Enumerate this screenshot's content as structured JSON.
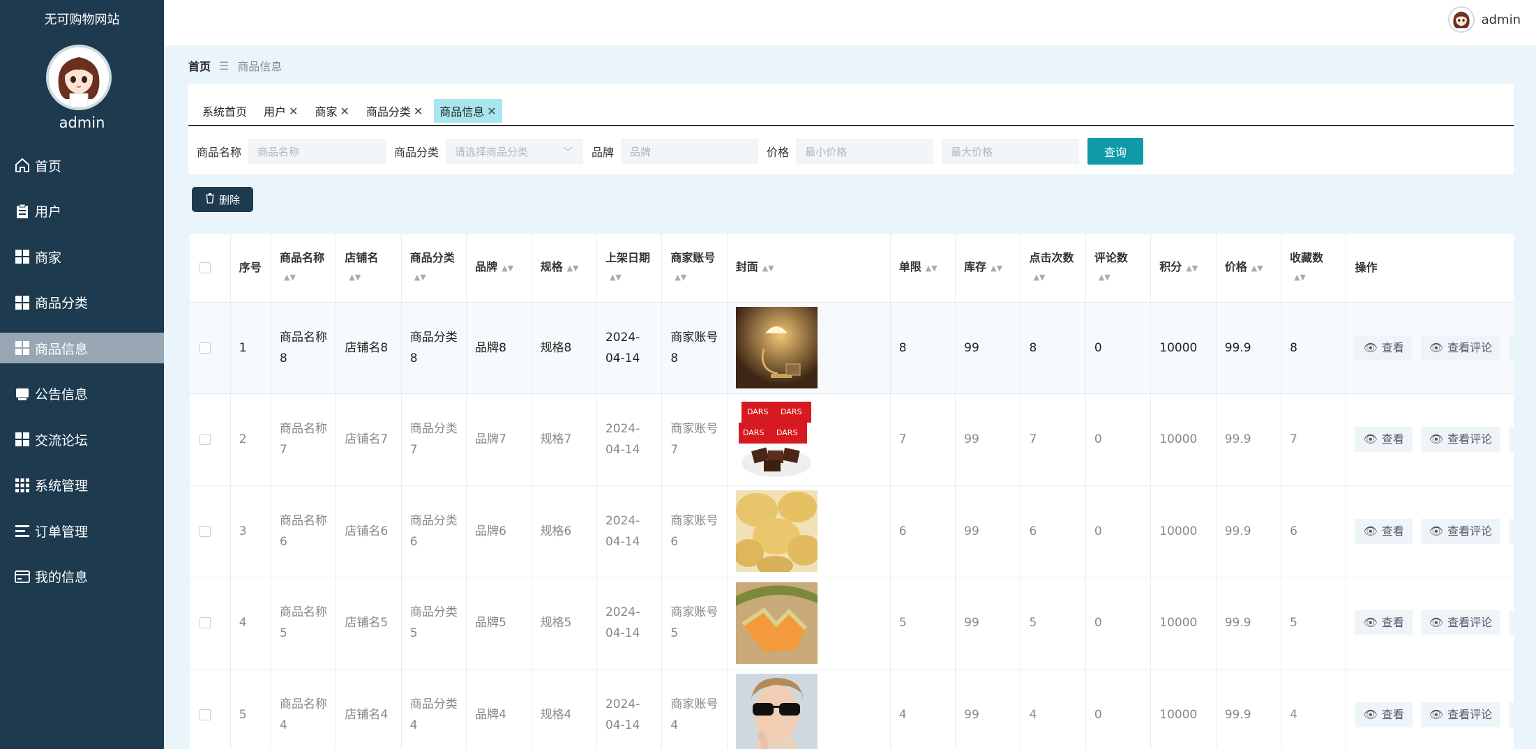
{
  "sidebar": {
    "site_title": "无可购物网站",
    "user_name": "admin",
    "items": [
      {
        "label": "首页",
        "icon": "home-icon"
      },
      {
        "label": "用户",
        "icon": "clipboard-icon"
      },
      {
        "label": "商家",
        "icon": "grid-icon"
      },
      {
        "label": "商品分类",
        "icon": "grid-icon"
      },
      {
        "label": "商品信息",
        "icon": "grid-icon",
        "active": true
      },
      {
        "label": "公告信息",
        "icon": "notice-icon"
      },
      {
        "label": "交流论坛",
        "icon": "grid-icon"
      },
      {
        "label": "系统管理",
        "icon": "apps-icon"
      },
      {
        "label": "订单管理",
        "icon": "list-icon"
      },
      {
        "label": "我的信息",
        "icon": "card-icon"
      }
    ]
  },
  "header": {
    "user_name": "admin"
  },
  "breadcrumb": {
    "home": "首页",
    "current": "商品信息"
  },
  "tabs": [
    {
      "label": "系统首页",
      "closable": false
    },
    {
      "label": "用户",
      "closable": true
    },
    {
      "label": "商家",
      "closable": true
    },
    {
      "label": "商品分类",
      "closable": true
    },
    {
      "label": "商品信息",
      "closable": true,
      "active": true
    }
  ],
  "search": {
    "name_label": "商品名称",
    "name_placeholder": "商品名称",
    "category_label": "商品分类",
    "category_placeholder": "请选择商品分类",
    "brand_label": "品牌",
    "brand_placeholder": "品牌",
    "price_label": "价格",
    "min_price_placeholder": "最小价格",
    "max_price_placeholder": "最大价格",
    "query_label": "查询"
  },
  "toolbar": {
    "delete_label": "删除"
  },
  "table": {
    "headers": [
      "序号",
      "商品名称",
      "店铺名",
      "商品分类",
      "品牌",
      "规格",
      "上架日期",
      "商家账号",
      "封面",
      "单限",
      "库存",
      "点击次数",
      "评论数",
      "积分",
      "价格",
      "收藏数",
      "操作"
    ],
    "view_label": "查看",
    "view_comments_label": "查看评论",
    "more_label": "×",
    "rows": [
      {
        "index": "1",
        "name": "商品名称8",
        "shop": "店铺名8",
        "category": "商品分类8",
        "brand": "品牌8",
        "spec": "规格8",
        "date": "2024-04-14",
        "account": "商家账号8",
        "cover": "lamp",
        "limit": "8",
        "stock": "99",
        "clicks": "8",
        "comments": "0",
        "points": "10000",
        "price": "99.9",
        "favorites": "8"
      },
      {
        "index": "2",
        "name": "商品名称7",
        "shop": "店铺名7",
        "category": "商品分类7",
        "brand": "品牌7",
        "spec": "规格7",
        "date": "2024-04-14",
        "account": "商家账号7",
        "cover": "chocolate",
        "limit": "7",
        "stock": "99",
        "clicks": "7",
        "comments": "0",
        "points": "10000",
        "price": "99.9",
        "favorites": "7"
      },
      {
        "index": "3",
        "name": "商品名称6",
        "shop": "店铺名6",
        "category": "商品分类6",
        "brand": "品牌6",
        "spec": "规格6",
        "date": "2024-04-14",
        "account": "商家账号6",
        "cover": "potatoes",
        "limit": "6",
        "stock": "99",
        "clicks": "6",
        "comments": "0",
        "points": "10000",
        "price": "99.9",
        "favorites": "6"
      },
      {
        "index": "4",
        "name": "商品名称5",
        "shop": "店铺名5",
        "category": "商品分类5",
        "brand": "品牌5",
        "spec": "规格5",
        "date": "2024-04-14",
        "account": "商家账号5",
        "cover": "melon",
        "limit": "5",
        "stock": "99",
        "clicks": "5",
        "comments": "0",
        "points": "10000",
        "price": "99.9",
        "favorites": "5"
      },
      {
        "index": "5",
        "name": "商品名称4",
        "shop": "店铺名4",
        "category": "商品分类4",
        "brand": "品牌4",
        "spec": "规格4",
        "date": "2024-04-14",
        "account": "商家账号4",
        "cover": "sunglasses",
        "limit": "4",
        "stock": "99",
        "clicks": "4",
        "comments": "0",
        "points": "10000",
        "price": "99.9",
        "favorites": "4"
      }
    ]
  },
  "colors": {
    "sidebar_bg": "#1d3a4f",
    "accent": "#0e9aa7",
    "active_tab": "#a8e6ef",
    "page_bg": "#eaf4fb"
  }
}
